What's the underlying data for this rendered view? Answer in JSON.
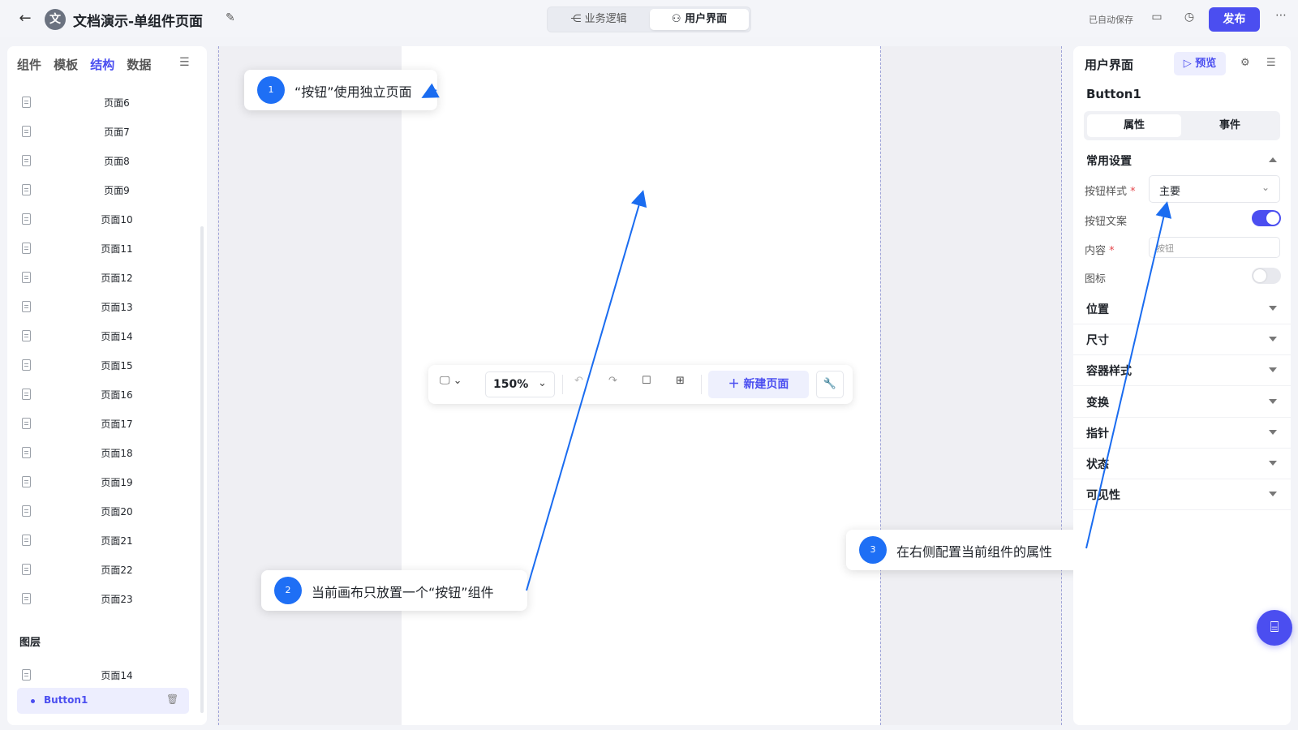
{
  "topbar": {
    "back_icon": "arrow-left-icon",
    "app_icon_char": "文",
    "title": "文档演示-单组件页面",
    "mode_tabs": [
      "业务逻辑",
      "用户界面"
    ],
    "autosave": "已自动保存",
    "publish": "发布"
  },
  "left": {
    "tabs": [
      "组件",
      "模板",
      "结构",
      "数据"
    ],
    "active_tab": "结构",
    "pages": [
      "页面6",
      "页面7",
      "页面8",
      "页面9",
      "页面10",
      "页面11",
      "页面12",
      "页面13",
      "页面14",
      "页面15",
      "页面16",
      "页面17",
      "页面18",
      "页面19",
      "页面20",
      "页面21",
      "页面22",
      "页面23"
    ],
    "layers_title": "图层",
    "layer_page": "页面14",
    "layer_component": "Button1"
  },
  "floatbar": {
    "zoom": "150%",
    "new_page": "新建页面"
  },
  "callouts": [
    {
      "num": "1",
      "text": "“按钮”使用独立页面"
    },
    {
      "num": "2",
      "text": "当前画布只放置一个“按钮”组件"
    },
    {
      "num": "3",
      "text": "在右侧配置当前组件的属性"
    }
  ],
  "right": {
    "title": "用户界面",
    "preview": "预览",
    "component": "Button1",
    "tabs": [
      "属性",
      "事件"
    ],
    "common_group": "常用设置",
    "props": {
      "style_label": "按钮样式",
      "style_value": "主要",
      "text_label": "按钮文案",
      "text_toggle": true,
      "content_label": "内容",
      "content_placeholder": "按钮",
      "icon_label": "图标",
      "icon_toggle": false
    },
    "sections": [
      "位置",
      "尺寸",
      "容器样式",
      "变换",
      "指针",
      "状态",
      "可见性"
    ]
  },
  "colors": {
    "accent": "#4b4ef0",
    "callout_blue": "#1e6ff5",
    "arrow_blue": "#1a6cf0"
  }
}
